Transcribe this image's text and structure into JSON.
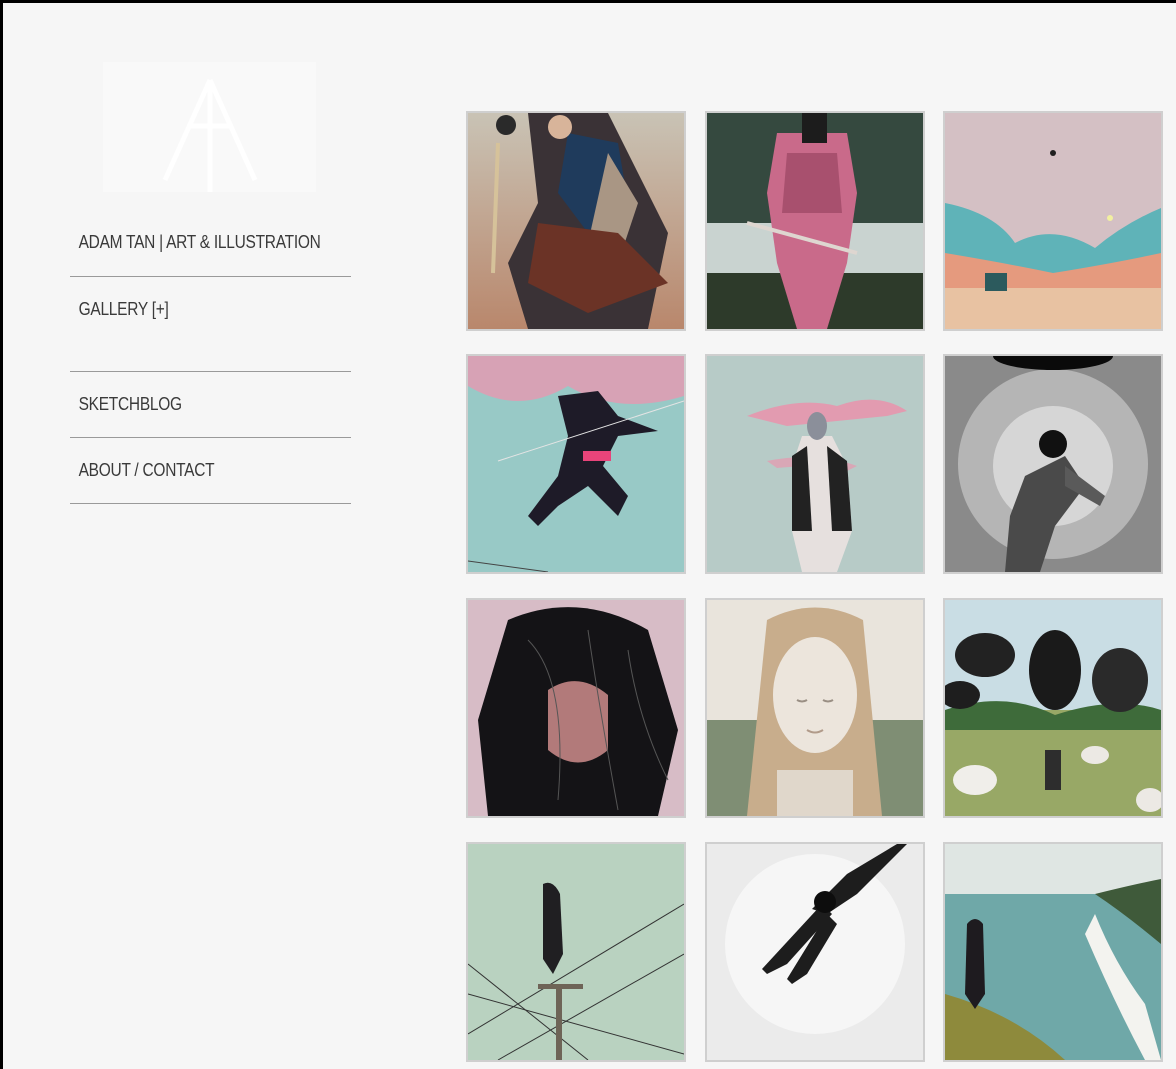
{
  "site": {
    "title": "ADAM TAN | ART & ILLUSTRATION",
    "logo_icon": "triangle-arrow-logo-icon"
  },
  "nav": {
    "items": [
      {
        "label": "ADAM TAN | ART & ILLUSTRATION"
      },
      {
        "label": "GALLERY [+]"
      },
      {
        "label": "SKETCHBLOG"
      },
      {
        "label": "ABOUT / CONTACT"
      }
    ]
  },
  "gallery": {
    "tiles": [
      {
        "name": "armored-warrior-painting"
      },
      {
        "name": "pink-samurai-painting"
      },
      {
        "name": "pastel-landscape-painting"
      },
      {
        "name": "leaping-figure-painting"
      },
      {
        "name": "standing-figure-painting"
      },
      {
        "name": "dark-figure-painting"
      },
      {
        "name": "dark-hair-portrait-painting"
      },
      {
        "name": "statue-face-painting"
      },
      {
        "name": "rugby-players-painting"
      },
      {
        "name": "powerline-figure-painting"
      },
      {
        "name": "falling-figure-painting"
      },
      {
        "name": "coastline-figure-painting"
      }
    ]
  },
  "colors": {
    "background": "#f6f6f6",
    "rule": "#9a9a9a",
    "tile_border": "#cfcfcf"
  }
}
